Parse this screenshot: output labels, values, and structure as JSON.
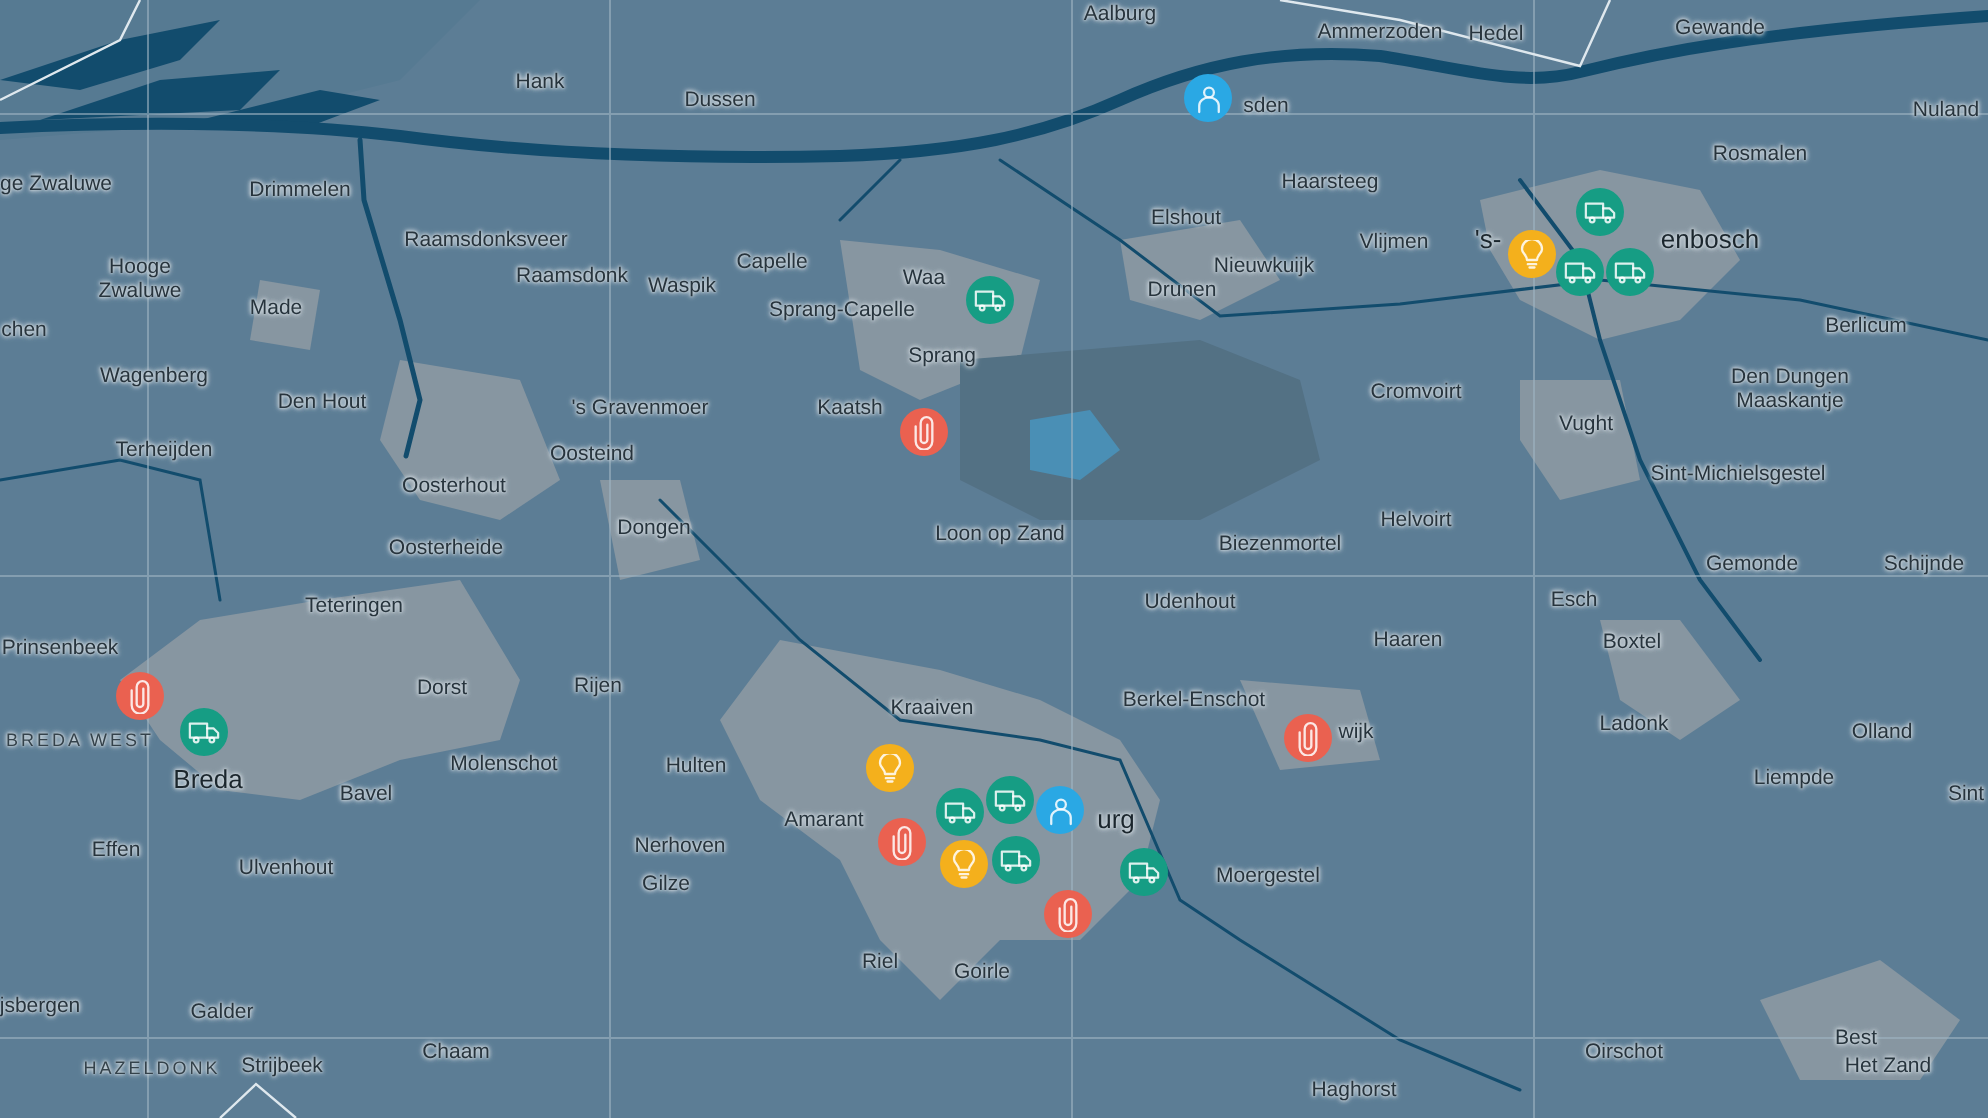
{
  "map": {
    "labels": [
      {
        "text": "Aalburg"
      },
      {
        "text": "Ammerzoden"
      },
      {
        "text": "Hedel"
      },
      {
        "text": "Gewande"
      },
      {
        "text": "Hank"
      },
      {
        "text": "Dussen"
      },
      {
        "text": "sden"
      },
      {
        "text": "Nuland"
      },
      {
        "text": "ge Zwaluwe"
      },
      {
        "text": "Drimmelen"
      },
      {
        "text": "Haarsteeg"
      },
      {
        "text": "Rosmalen"
      },
      {
        "text": "Raamsdonksveer"
      },
      {
        "text": "Elshout"
      },
      {
        "text": "Vlijmen"
      },
      {
        "text": "'s-"
      },
      {
        "text": "enbosch"
      },
      {
        "text": "Hooge Zwaluwe"
      },
      {
        "text": "Raamsdonk"
      },
      {
        "text": "Waspik"
      },
      {
        "text": "Capelle"
      },
      {
        "text": "Waa"
      },
      {
        "text": "Drunen"
      },
      {
        "text": "Nieuwkuijk"
      },
      {
        "text": "chen"
      },
      {
        "text": "Made"
      },
      {
        "text": "Sprang-Capelle"
      },
      {
        "text": "Sprang"
      },
      {
        "text": "Berlicum"
      },
      {
        "text": "Wagenberg"
      },
      {
        "text": "Den Hout"
      },
      {
        "text": "'s Gravenmoer"
      },
      {
        "text": "Kaatsh"
      },
      {
        "text": "Cromvoirt"
      },
      {
        "text": "Vught"
      },
      {
        "text": "Den Dungen Maaskantje"
      },
      {
        "text": "Terheijden"
      },
      {
        "text": "Oosterhout"
      },
      {
        "text": "Oosteind"
      },
      {
        "text": "Sint-Michielsgestel"
      },
      {
        "text": "Oosterheide"
      },
      {
        "text": "Dongen"
      },
      {
        "text": "Loon op Zand"
      },
      {
        "text": "Biezenmortel"
      },
      {
        "text": "Helvoirt"
      },
      {
        "text": "Gemonde"
      },
      {
        "text": "Schijnde"
      },
      {
        "text": "Teteringen"
      },
      {
        "text": "Udenhout"
      },
      {
        "text": "Esch"
      },
      {
        "text": "Prinsenbeek"
      },
      {
        "text": "Haaren"
      },
      {
        "text": "Boxtel"
      },
      {
        "text": "Dorst"
      },
      {
        "text": "Rijen"
      },
      {
        "text": "Berkel-Enschot"
      },
      {
        "text": "BREDA WEST"
      },
      {
        "text": "Kraaiven"
      },
      {
        "text": "wijk"
      },
      {
        "text": "Ladonk"
      },
      {
        "text": "Olland"
      },
      {
        "text": "Breda"
      },
      {
        "text": "Bavel"
      },
      {
        "text": "Molenschot"
      },
      {
        "text": "Hulten"
      },
      {
        "text": "Liempde"
      },
      {
        "text": "Sint"
      },
      {
        "text": "Effen"
      },
      {
        "text": "Ulvenhout"
      },
      {
        "text": "Nerhoven"
      },
      {
        "text": "Gilze"
      },
      {
        "text": "Amarant"
      },
      {
        "text": "urg"
      },
      {
        "text": "Moergestel"
      },
      {
        "text": "jsbergen"
      },
      {
        "text": "Galder"
      },
      {
        "text": "Riel"
      },
      {
        "text": "Goirle"
      },
      {
        "text": "HAZELDONK"
      },
      {
        "text": "Strijbeek"
      },
      {
        "text": "Chaam"
      },
      {
        "text": "Haghorst"
      },
      {
        "text": "Oirschot"
      },
      {
        "text": "Best"
      },
      {
        "text": "Het Zand"
      }
    ],
    "markers": [
      {
        "kind": "person",
        "color": "#2aa8e4"
      },
      {
        "kind": "truck",
        "color": "#169d84"
      },
      {
        "kind": "paperclip",
        "color": "#ea6150"
      },
      {
        "kind": "truck",
        "color": "#169d84"
      },
      {
        "kind": "lightbulb",
        "color": "#f4b01c"
      },
      {
        "kind": "truck",
        "color": "#169d84"
      },
      {
        "kind": "truck",
        "color": "#169d84"
      },
      {
        "kind": "paperclip",
        "color": "#ea6150"
      },
      {
        "kind": "truck",
        "color": "#169d84"
      },
      {
        "kind": "lightbulb",
        "color": "#f4b01c"
      },
      {
        "kind": "paperclip",
        "color": "#ea6150"
      },
      {
        "kind": "truck",
        "color": "#169d84"
      },
      {
        "kind": "truck",
        "color": "#169d84"
      },
      {
        "kind": "person",
        "color": "#2aa8e4"
      },
      {
        "kind": "lightbulb",
        "color": "#f4b01c"
      },
      {
        "kind": "truck",
        "color": "#169d84"
      },
      {
        "kind": "truck",
        "color": "#169d84"
      },
      {
        "kind": "paperclip",
        "color": "#ea6150"
      },
      {
        "kind": "paperclip",
        "color": "#ea6150"
      }
    ]
  }
}
